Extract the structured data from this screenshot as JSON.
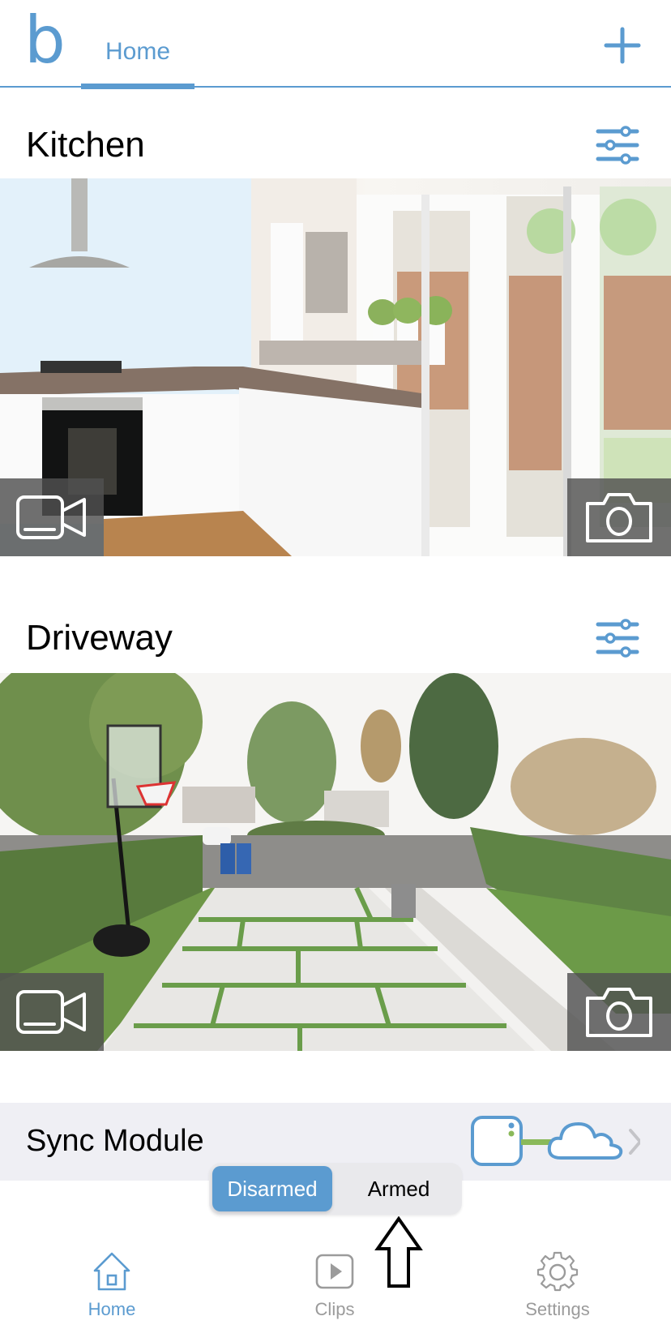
{
  "app": {
    "logo_letter": "b",
    "accent_color": "#5b9bd0"
  },
  "header": {
    "tabs": [
      {
        "label": "Home",
        "active": true
      }
    ],
    "add_icon": "plus-icon"
  },
  "cameras": [
    {
      "name": "Kitchen",
      "settings_icon": "sliders-icon",
      "live_view_icon": "video-camera-icon",
      "snapshot_icon": "camera-icon"
    },
    {
      "name": "Driveway",
      "settings_icon": "sliders-icon",
      "live_view_icon": "video-camera-icon",
      "snapshot_icon": "camera-icon"
    }
  ],
  "sync_module": {
    "label": "Sync Module",
    "status_icon": "sync-module-cloud-connected-icon",
    "connection_color": "#8ab95a",
    "chevron_icon": "chevron-right-icon"
  },
  "arm_toggle": {
    "options": [
      "Disarmed",
      "Armed"
    ],
    "selected": "Disarmed"
  },
  "bottom_nav": {
    "items": [
      {
        "label": "Home",
        "icon": "home-icon",
        "active": true
      },
      {
        "label": "Clips",
        "icon": "play-clip-icon",
        "active": false
      },
      {
        "label": "Settings",
        "icon": "gear-icon",
        "active": false
      }
    ]
  }
}
